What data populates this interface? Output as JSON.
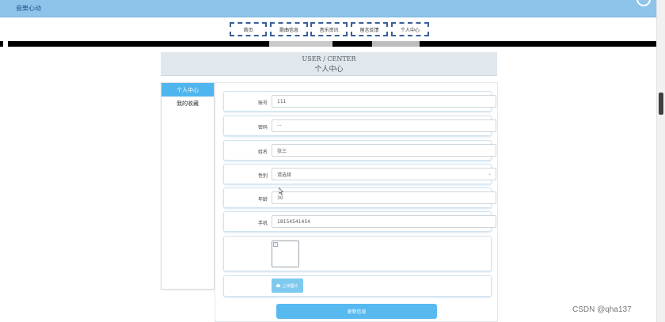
{
  "topbar": {
    "site_title": "音樂心动"
  },
  "nav": {
    "items": [
      {
        "label": "首页"
      },
      {
        "label": "歌曲信息"
      },
      {
        "label": "音乐资讯"
      },
      {
        "label": "留言反馈"
      },
      {
        "label": "个人中心"
      }
    ]
  },
  "header": {
    "en": "USER / CENTER",
    "zh": "个人中心"
  },
  "sidebar": {
    "items": [
      {
        "label": "个人中心",
        "active": true
      },
      {
        "label": "我的收藏",
        "active": false
      }
    ]
  },
  "form": {
    "account": {
      "label": "账号",
      "value": "111"
    },
    "password": {
      "label": "密码",
      "value": "···"
    },
    "name": {
      "label": "姓名",
      "value": "张三"
    },
    "gender": {
      "label": "性别",
      "placeholder": "请选择"
    },
    "age": {
      "label": "年龄",
      "value": "30"
    },
    "phone": {
      "label": "手机",
      "value": "18154541454"
    },
    "upload_label": "上传图片",
    "submit_label": "更新信息"
  },
  "watermark": "CSDN @qha137",
  "colors": {
    "accent": "#58b9ef",
    "topbar": "#8ec3ea"
  }
}
